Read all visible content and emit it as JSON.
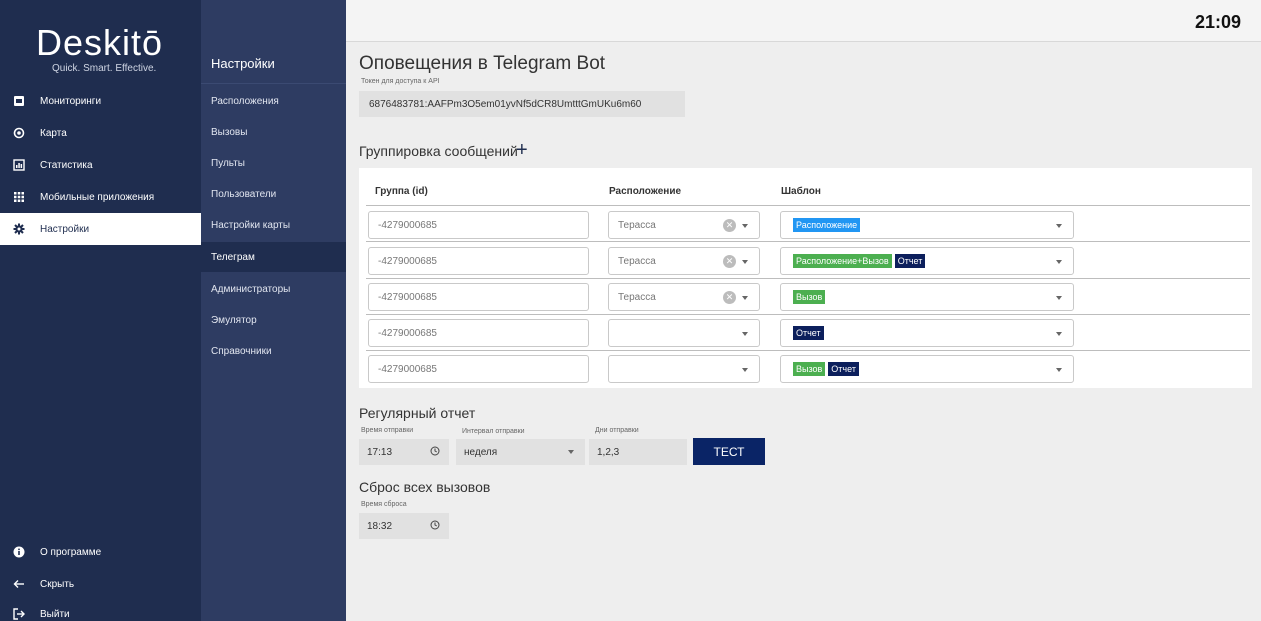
{
  "app": {
    "logo": "Deskitō",
    "tagline": "Quick. Smart. Effective.",
    "clock": "21:09"
  },
  "sidebar": {
    "items": [
      {
        "label": "Мониторинги",
        "icon": "monitor-icon"
      },
      {
        "label": "Карта",
        "icon": "map-target-icon"
      },
      {
        "label": "Статистика",
        "icon": "chart-icon"
      },
      {
        "label": "Мобильные приложения",
        "icon": "apps-grid-icon"
      },
      {
        "label": "Настройки",
        "icon": "gear-icon",
        "active": true
      }
    ],
    "bottom": [
      {
        "label": "О программе",
        "icon": "info-icon"
      },
      {
        "label": "Скрыть",
        "icon": "arrow-left-icon"
      },
      {
        "label": "Выйти",
        "icon": "logout-icon"
      }
    ]
  },
  "subnav": {
    "title": "Настройки",
    "items": [
      "Расположения",
      "Вызовы",
      "Пульты",
      "Пользователи",
      "Настройки карты",
      "Телеграм",
      "Администраторы",
      "Эмулятор",
      "Справочники"
    ],
    "active": "Телеграм"
  },
  "telegram": {
    "title": "Оповещения в Telegram Bot",
    "token_label": "Токен для доступа к API",
    "token_value": "6876483781:AAFPm3O5em01yvNf5dCR8UmtttGmUKu6m60"
  },
  "grouping": {
    "title": "Группировка сообщений",
    "add_symbol": "+",
    "headers": {
      "group": "Группа (id)",
      "location": "Расположение",
      "template": "Шаблон"
    },
    "rows": [
      {
        "group": "-4279000685",
        "location": "Терасса",
        "tags": [
          {
            "text": "Расположение",
            "kind": "loc"
          }
        ]
      },
      {
        "group": "-4279000685",
        "location": "Терасса",
        "tags": [
          {
            "text": "Расположение+Вызов",
            "kind": "locv"
          },
          {
            "text": "Отчет",
            "kind": "rep"
          }
        ]
      },
      {
        "group": "-4279000685",
        "location": "Терасса",
        "tags": [
          {
            "text": "Вызов",
            "kind": "call"
          }
        ]
      },
      {
        "group": "-4279000685",
        "location": "",
        "tags": [
          {
            "text": "Отчет",
            "kind": "rep"
          }
        ]
      },
      {
        "group": "-4279000685",
        "location": "",
        "tags": [
          {
            "text": "Вызов",
            "kind": "call"
          },
          {
            "text": "Отчет",
            "kind": "rep"
          }
        ]
      }
    ]
  },
  "report": {
    "title": "Регулярный отчет",
    "time_label": "Время отправки",
    "time_value": "17:13",
    "interval_label": "Интервал отправки",
    "interval_value": "неделя",
    "days_label": "Дни отправки",
    "days_value": "1,2,3",
    "test_button": "ТЕСТ"
  },
  "reset": {
    "title": "Сброс всех вызовов",
    "time_label": "Время сброса",
    "time_value": "18:32"
  },
  "colors": {
    "sidebar": "#1f2d4f",
    "subnav": "#2e3c62",
    "accent": "#0a2466",
    "tag_blue": "#2196f3",
    "tag_green": "#4caf50",
    "tag_navy": "#0c1f5c"
  }
}
